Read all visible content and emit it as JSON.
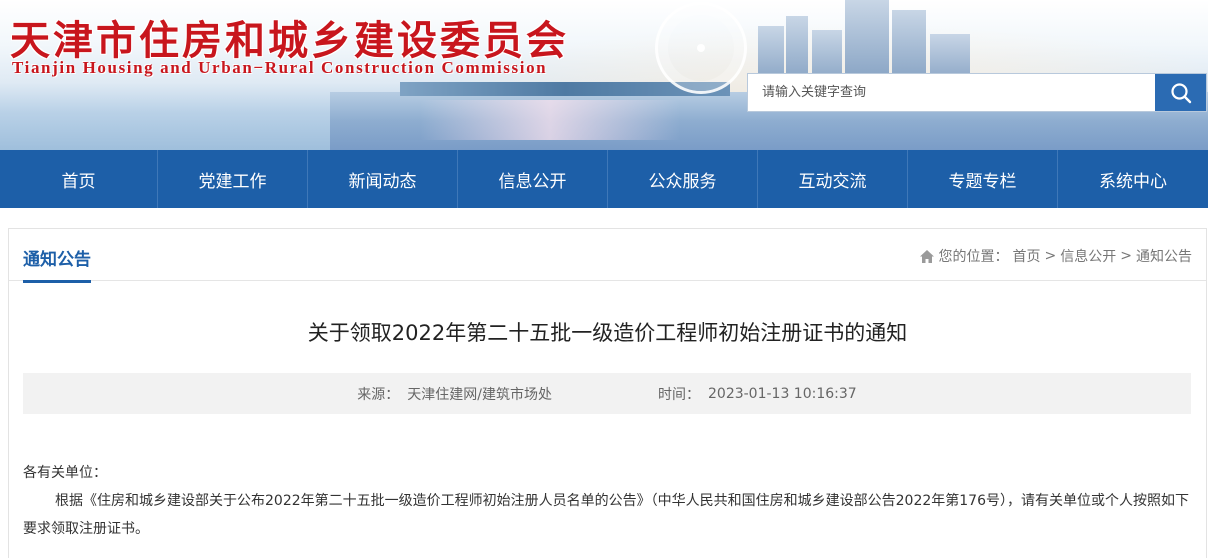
{
  "header": {
    "title": "天津市住房和城乡建设委员会",
    "subtitle": "Tianjin Housing and Urban−Rural Construction Commission",
    "search": {
      "placeholder": "请输入关键字查询"
    },
    "icons": {
      "search": "search-icon"
    }
  },
  "nav": {
    "items": [
      {
        "label": "首页"
      },
      {
        "label": "党建工作"
      },
      {
        "label": "新闻动态"
      },
      {
        "label": "信息公开"
      },
      {
        "label": "公众服务"
      },
      {
        "label": "互动交流"
      },
      {
        "label": "专题专栏"
      },
      {
        "label": "系统中心"
      }
    ]
  },
  "section": {
    "title": "通知公告",
    "breadcrumb": {
      "prefix": "您的位置：",
      "items": [
        "首页",
        "信息公开",
        "通知公告"
      ],
      "separator": ">",
      "icon": "home-icon"
    }
  },
  "article": {
    "title": "关于领取2022年第二十五批一级造价工程师初始注册证书的通知",
    "source_label": "来源：",
    "source": "天津住建网/建筑市场处",
    "time_label": "时间：",
    "time": "2023-01-13 10:16:37",
    "salutation": "各有关单位：",
    "paragraph": "根据《住房和城乡建设部关于公布2022年第二十五批一级造价工程师初始注册人员名单的公告》（中华人民共和国住房和城乡建设部公告2022年第176号），请有关单位或个人按照如下要求领取注册证书。"
  },
  "colors": {
    "brand_red": "#c8161d",
    "nav_blue": "#1d5fa8",
    "search_blue": "#2b6bb3"
  }
}
